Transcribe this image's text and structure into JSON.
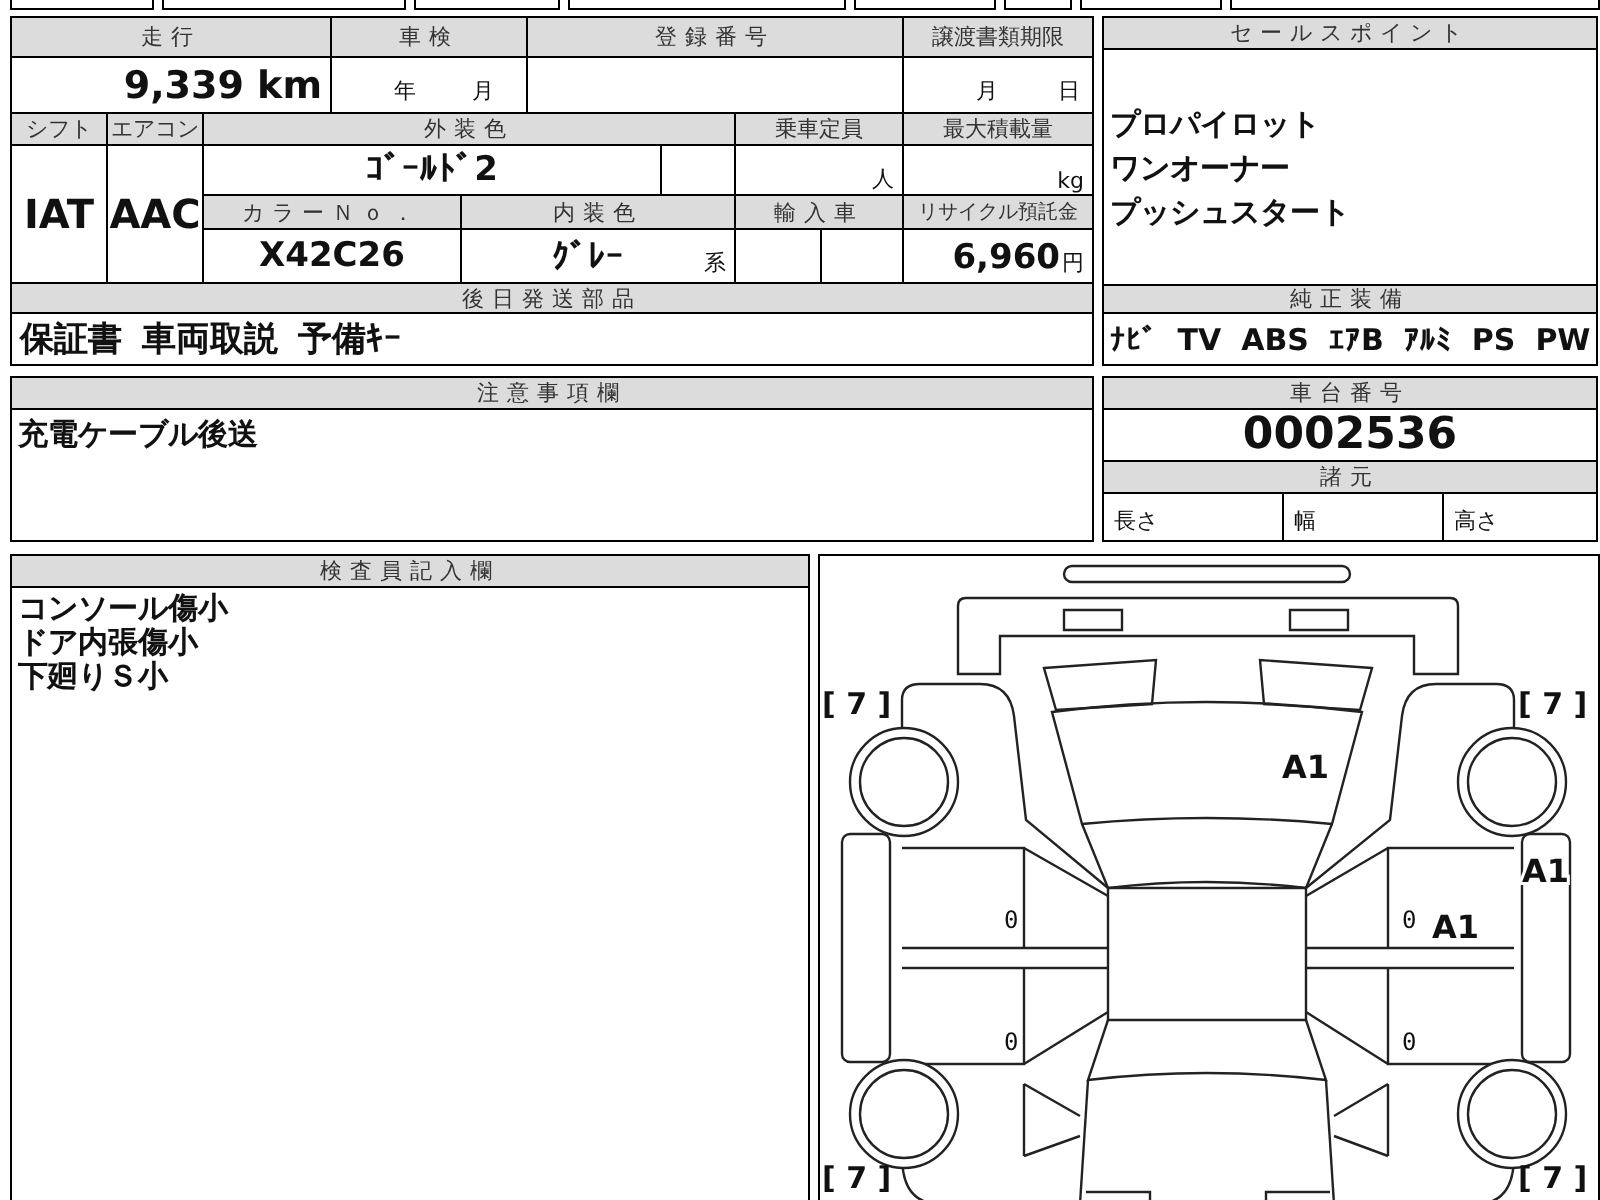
{
  "vehicle_info": {
    "mileage": {
      "label": "走行",
      "value": "9,339 km"
    },
    "inspection": {
      "label": "車検",
      "year_unit": "年",
      "month_unit": "月"
    },
    "registration_number": {
      "label": "登録番号"
    },
    "document_deadline": {
      "label": "譲渡書類期限",
      "month_unit": "月",
      "day_unit": "日"
    },
    "shift": {
      "label": "シフト",
      "value": "IAT"
    },
    "air_conditioning": {
      "label": "エアコン",
      "value": "AAC"
    },
    "exterior_color": {
      "label": "外装色",
      "value": "ｺﾞｰﾙﾄﾞ2"
    },
    "seating_capacity": {
      "label": "乗車定員",
      "unit": "人"
    },
    "max_load": {
      "label": "最大積載量",
      "unit": "kg"
    },
    "color_number": {
      "label": "カラーＮｏ．",
      "value": "X42C26"
    },
    "interior_color": {
      "label": "内装色",
      "value": "ｸﾞﾚｰ",
      "suffix": "系"
    },
    "imported": {
      "label": "輸入車"
    },
    "recycling_deposit": {
      "label": "リサイクル預託金",
      "value": "6,960",
      "unit": "円"
    }
  },
  "delivery_parts": {
    "label": "後日発送部品",
    "items": [
      "保証書",
      "車両取説",
      "予備ｷｰ"
    ]
  },
  "sales_points": {
    "label": "セールスポイント",
    "items": [
      "プロパイロット",
      "ワンオーナー",
      "プッシュスタート"
    ]
  },
  "standard_equipment": {
    "label": "純正装備",
    "items": [
      "ﾅﾋﾞ",
      "TV",
      "ABS",
      "ｴｱB",
      "ｱﾙﾐ",
      "PS",
      "PW"
    ]
  },
  "notes": {
    "label": "注意事項欄",
    "text": "充電ケーブル後送"
  },
  "chassis_number": {
    "label": "車台番号",
    "value": "0002536"
  },
  "specifications": {
    "label": "諸元",
    "items": [
      "長さ",
      "幅",
      "高さ"
    ]
  },
  "inspector_notes": {
    "label": "検査員記入欄",
    "lines": [
      "コンソール傷小",
      "ドア内張傷小",
      "下廻りＳ小"
    ]
  },
  "damage_diagram": {
    "tire_top_left": "[ 7 ]",
    "tire_top_right": "[ 7 ]",
    "windshield": "A1",
    "right_side_strip": "A1",
    "left_upper_door": "0",
    "right_upper_door": "0",
    "right_upper_door_panel": "A1",
    "left_lower_door": "0",
    "right_lower_door": "0",
    "tire_bottom_left": "[ 7 ]",
    "tire_bottom_right": "[ 7 ]"
  }
}
